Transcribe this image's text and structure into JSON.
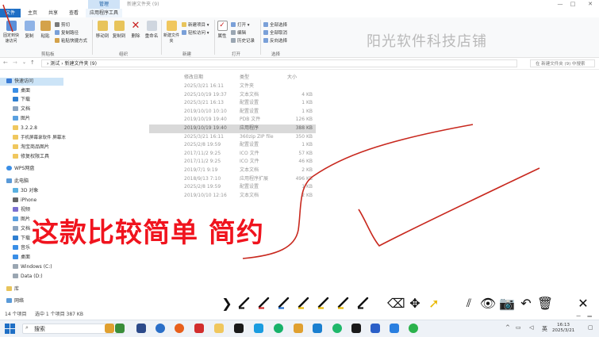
{
  "titlebar": {
    "context_tab": "管理",
    "window_title": "新建文件夹 (9)",
    "min": "—",
    "max": "□",
    "close": "✕"
  },
  "tabs": {
    "file": "文件",
    "home": "主页",
    "share": "共享",
    "view": "查看",
    "app_tools": "应用程序工具"
  },
  "ribbon": {
    "pin": "固定到快速访问",
    "copy": "复制",
    "paste": "粘贴",
    "cut": "剪切",
    "copy_path": "复制路径",
    "paste_shortcut": "粘贴快捷方式",
    "move_to": "移动到",
    "copy_to": "复制到",
    "delete": "删除",
    "rename": "重命名",
    "new_folder": "新建文件夹",
    "new_item": "新建项目 ▾",
    "easy_access": "轻松访问 ▾",
    "properties": "属性",
    "open": "打开 ▾",
    "edit": "编辑",
    "history": "历史记录",
    "select_all": "全部选择",
    "select_none": "全部取消",
    "invert": "反向选择",
    "group_clipboard": "剪贴板",
    "group_organize": "组织",
    "group_new": "新建",
    "group_open": "打开",
    "group_select": "选择"
  },
  "watermark": "阳光软件科技店铺",
  "address": {
    "path": "› 测试 › 新建文件夹 (9)",
    "search_placeholder": "在 新建文件夹 (9) 中搜索"
  },
  "nav": {
    "quick_access": "快速访问",
    "desktop": "桌面",
    "downloads": "下载",
    "documents": "文档",
    "pictures": "图片",
    "i1": "3.2.2.8",
    "i2": "手机屏幕录软件 屏幕冻",
    "i3": "淘宝商品图片",
    "i4": "修复权限工具",
    "wps": "WPS网盘",
    "this_pc": "此电脑",
    "obj3d": "3D 对象",
    "iphone": "iPhone",
    "videos": "视频",
    "pictures2": "图片",
    "documents2": "文档",
    "downloads2": "下载",
    "music": "音乐",
    "desktop2": "桌面",
    "drive_c": "Windows (C:)",
    "drive_d": "Data (D:)",
    "libraries": "库",
    "network": "网络"
  },
  "columns": {
    "date": "修改日期",
    "type": "类型",
    "size": "大小"
  },
  "files": [
    {
      "date": "2025/3/21 16:11",
      "type": "文件夹",
      "size": ""
    },
    {
      "date": "2025/10/19 19:37",
      "type": "文本文档",
      "size": "4 KB"
    },
    {
      "date": "2025/3/21 16:13",
      "type": "配置设置",
      "size": "1 KB"
    },
    {
      "date": "2019/10/10 10:10",
      "type": "配置设置",
      "size": "1 KB"
    },
    {
      "date": "2019/10/19 19:40",
      "type": "PDB 文件",
      "size": "126 KB"
    },
    {
      "date": "2019/10/19 19:40",
      "type": "应用程序",
      "size": "388 KB"
    },
    {
      "date": "2025/3/21 16:11",
      "type": "360zip ZIP file",
      "size": "350 KB"
    },
    {
      "date": "2025/2/8 19:59",
      "type": "配置设置",
      "size": "1 KB"
    },
    {
      "date": "2017/11/2 9:25",
      "type": "ICO 文件",
      "size": "57 KB"
    },
    {
      "date": "2017/11/2 9:25",
      "type": "ICO 文件",
      "size": "46 KB"
    },
    {
      "date": "2019/7/1 9:19",
      "type": "文本文档",
      "size": "2 KB"
    },
    {
      "date": "2018/9/13 7:10",
      "type": "应用程序扩展",
      "size": "496 KB"
    },
    {
      "date": "2025/2/8 19:59",
      "type": "配置设置",
      "size": "1 KB"
    },
    {
      "date": "2019/10/10 12:16",
      "type": "文本文档",
      "size": "2 KB"
    }
  ],
  "status": {
    "count": "14 个项目",
    "selected": "选中 1 个项目 387 KB"
  },
  "overlay": "这款比较简单 简约",
  "annotation_tools": {
    "collapse": "❯",
    "eraser": "⌫",
    "move": "✥",
    "pointer": "➚",
    "eye": "👁",
    "camera": "📷",
    "undo": "↶",
    "trash": "🗑",
    "close": "✕"
  },
  "pen_colors": [
    "#1b1b1b",
    "#d62b2b",
    "#1e6fd6",
    "#e9b800",
    "#e9b800",
    "#e9b800",
    "#1b1b1b"
  ],
  "taskbar": {
    "search": "搜索",
    "ime": "英",
    "time": "16:13",
    "date": "2025/3/21"
  }
}
